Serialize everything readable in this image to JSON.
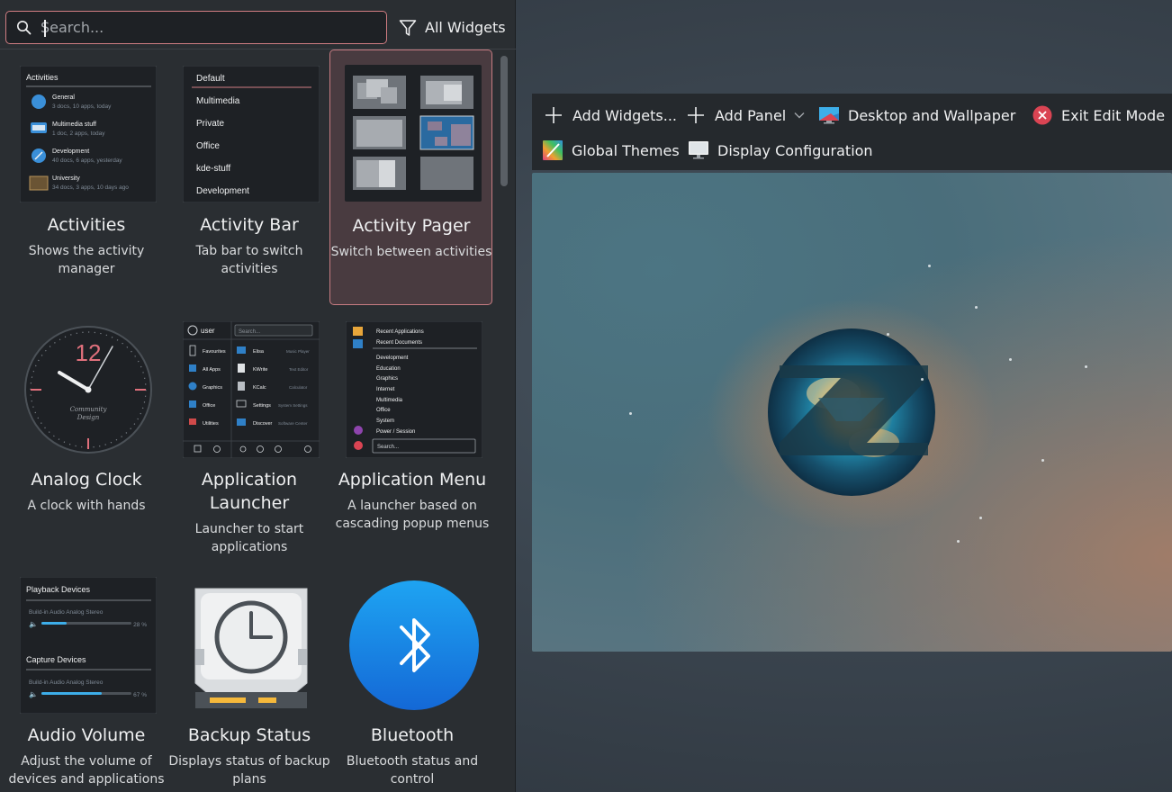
{
  "search": {
    "placeholder": "Search...",
    "value": ""
  },
  "filter": {
    "label": "All Widgets",
    "icon": "filter-icon"
  },
  "widgets": [
    {
      "title": "Activities",
      "desc": "Shows the activity manager"
    },
    {
      "title": "Activity Bar",
      "desc": "Tab bar to switch activities"
    },
    {
      "title": "Activity Pager",
      "desc": "Switch between activities",
      "selected": true
    },
    {
      "title": "Analog Clock",
      "desc": "A clock with hands"
    },
    {
      "title": "Application Launcher",
      "desc": "Launcher to start applications"
    },
    {
      "title": "Application Menu",
      "desc": "A launcher based on cascading popup menus"
    },
    {
      "title": "Audio Volume",
      "desc": "Adjust the volume of devices and applications"
    },
    {
      "title": "Backup Status",
      "desc": "Displays status of backup plans"
    },
    {
      "title": "Bluetooth",
      "desc": "Bluetooth status and control"
    }
  ],
  "thumbs": {
    "activities": {
      "header": "Activities",
      "items": [
        {
          "name": "General",
          "detail": "3 docs, 10 apps, today"
        },
        {
          "name": "Multimedia stuff",
          "detail": "1 doc, 2 apps, today"
        },
        {
          "name": "Development",
          "detail": "40 docs, 6 apps, yesterday"
        },
        {
          "name": "University",
          "detail": "34 docs, 3 apps, 10 days ago"
        }
      ]
    },
    "activity_bar": {
      "items": [
        "Default",
        "Multimedia",
        "Private",
        "Office",
        "kde-stuff",
        "Development"
      ]
    },
    "clock": {
      "number": "12",
      "caption_line1": "Community",
      "caption_line2": "Design"
    },
    "launcher": {
      "user": "user",
      "search": "Search...",
      "left": [
        "Favourites",
        "All Apps",
        "Graphics",
        "Office",
        "Utilities"
      ],
      "right": [
        {
          "name": "Elisa",
          "detail": "Music Player"
        },
        {
          "name": "KWrite",
          "detail": "Text Editor"
        },
        {
          "name": "KCalc",
          "detail": "Calculator"
        },
        {
          "name": "Settings",
          "detail": "System Settings"
        },
        {
          "name": "Discover",
          "detail": "Software Center"
        }
      ]
    },
    "app_menu": {
      "items": [
        "Recent Applications",
        "Recent Documents",
        "Development",
        "Education",
        "Graphics",
        "Internet",
        "Multimedia",
        "Office",
        "System",
        "Power / Session"
      ],
      "search": "Search..."
    },
    "audio": {
      "playback_header": "Playback Devices",
      "playback_device": "Build-in Audio Analog Stereo",
      "playback_percent": "28 %",
      "playback_level": 0.28,
      "capture_header": "Capture Devices",
      "capture_device": "Build-in Audio Analog Stereo",
      "capture_percent": "67 %",
      "capture_level": 0.67
    }
  },
  "toolbar": {
    "add_widgets": "Add Widgets...",
    "add_panel": "Add Panel",
    "desktop_wallpaper": "Desktop and Wallpaper",
    "exit_edit": "Exit Edit Mode",
    "global_themes": "Global Themes",
    "display_config": "Display Configuration"
  },
  "colors": {
    "accent": "#d07d82",
    "panel_bg": "#2a2e32",
    "toolbar_bg": "#25292d",
    "exit_red": "#da4453",
    "bluetooth_blue": "#1d8cf0"
  }
}
